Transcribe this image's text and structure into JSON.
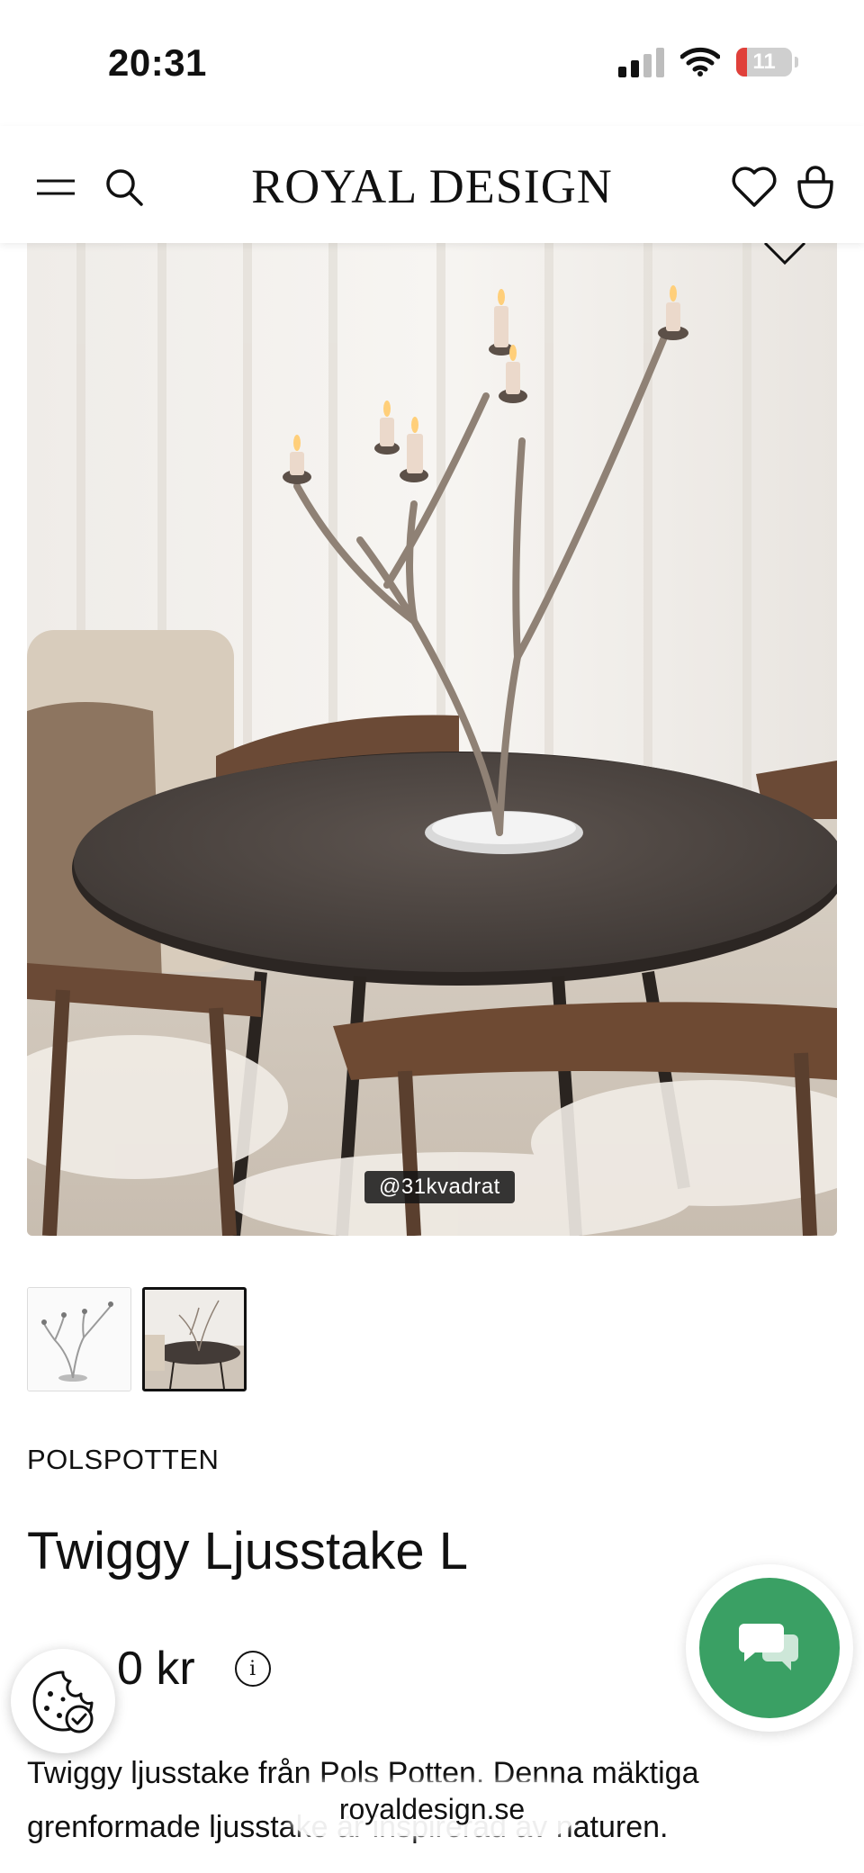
{
  "status_bar": {
    "time": "20:31",
    "battery": "11"
  },
  "header": {
    "logo": "ROYAL DESIGN",
    "icons": [
      "menu-icon",
      "search-icon",
      "heart-icon",
      "bag-icon"
    ]
  },
  "gallery": {
    "watermark": "@31kvadrat",
    "thumbnails": [
      "product-thumbnail-1",
      "product-thumbnail-2"
    ],
    "active_thumbnail": 2
  },
  "product": {
    "brand": "POLSPOTTEN",
    "title": "Twiggy Ljusstake L",
    "price": "0 kr",
    "info_glyph": "i",
    "description": "Twiggy ljusstake från Pols Potten. Denna mäktiga grenformade ljusstake är inspirerad av naturen."
  },
  "browser": {
    "url": "royaldesign.se"
  },
  "colors": {
    "chat_green": "#3aa064",
    "battery_red": "#e0403a"
  }
}
